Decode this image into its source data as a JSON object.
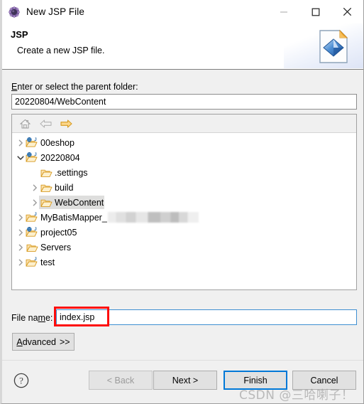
{
  "window": {
    "title": "New JSP File",
    "title_icon": "jsp-wizard-icon",
    "controls": [
      {
        "name": "minimize-button",
        "glyph": "minimize-icon",
        "enabled": false
      },
      {
        "name": "maximize-button",
        "glyph": "maximize-icon",
        "enabled": true
      },
      {
        "name": "close-button",
        "glyph": "close-icon",
        "enabled": true
      }
    ]
  },
  "header": {
    "title": "JSP",
    "description": "Create a new JSP file.",
    "icon": "jsp-file-banner-icon"
  },
  "parent_folder": {
    "label": "Enter or select the parent folder:",
    "label_mnemonic": "E",
    "value": "20220804/WebContent",
    "placeholder": ""
  },
  "tree_toolbar": {
    "buttons": [
      {
        "name": "home-icon",
        "title": "Home",
        "enabled": false
      },
      {
        "name": "back-arrow-icon",
        "title": "Back",
        "enabled": false
      },
      {
        "name": "forward-arrow-icon",
        "title": "Forward",
        "enabled": true
      }
    ]
  },
  "tree": {
    "items": [
      {
        "label": "00eshop",
        "depth": 0,
        "icon": "web-project-icon",
        "twisty": "collapsed",
        "selected": false,
        "redacted": false
      },
      {
        "label": "20220804",
        "depth": 0,
        "icon": "web-project-icon",
        "twisty": "expanded",
        "selected": false,
        "redacted": false
      },
      {
        "label": ".settings",
        "depth": 1,
        "icon": "folder-icon",
        "twisty": "none",
        "selected": false,
        "redacted": false
      },
      {
        "label": "build",
        "depth": 1,
        "icon": "folder-icon",
        "twisty": "collapsed",
        "selected": false,
        "redacted": false
      },
      {
        "label": "WebContent",
        "depth": 1,
        "icon": "folder-icon",
        "twisty": "collapsed",
        "selected": true,
        "redacted": false
      },
      {
        "label": "MyBatisMapper_",
        "depth": 0,
        "icon": "java-project-icon",
        "twisty": "collapsed",
        "selected": false,
        "redacted": true
      },
      {
        "label": "project05",
        "depth": 0,
        "icon": "web-project-icon",
        "twisty": "collapsed",
        "selected": false,
        "redacted": false
      },
      {
        "label": "Servers",
        "depth": 0,
        "icon": "folder-icon",
        "twisty": "collapsed",
        "selected": false,
        "redacted": false
      },
      {
        "label": "test",
        "depth": 0,
        "icon": "java-project-icon",
        "twisty": "collapsed",
        "selected": false,
        "redacted": false
      }
    ]
  },
  "file_name": {
    "label": "File name:",
    "label_mnemonic": "m",
    "value": "index.jsp",
    "placeholder": "",
    "highlight_color": "#fd0d0c"
  },
  "advanced": {
    "label": "Advanced",
    "chevrons": ">>"
  },
  "footer": {
    "help_icon": "help-question-icon",
    "buttons": [
      {
        "name": "back-button",
        "label": "< Back",
        "enabled": false,
        "focused": false
      },
      {
        "name": "next-button",
        "label": "Next >",
        "enabled": true,
        "focused": false
      },
      {
        "name": "finish-button",
        "label": "Finish",
        "enabled": true,
        "focused": true
      },
      {
        "name": "cancel-button",
        "label": "Cancel",
        "enabled": true,
        "focused": false
      }
    ]
  },
  "watermark": {
    "text": "CSDN @三哈喇子！"
  },
  "colors": {
    "accent": "#0078d7",
    "dialog_bg": "#f0f0f0",
    "annotation_red": "#fd0d0c",
    "selection_bg": "#dededd",
    "folder_gold": "#e8a33d"
  }
}
